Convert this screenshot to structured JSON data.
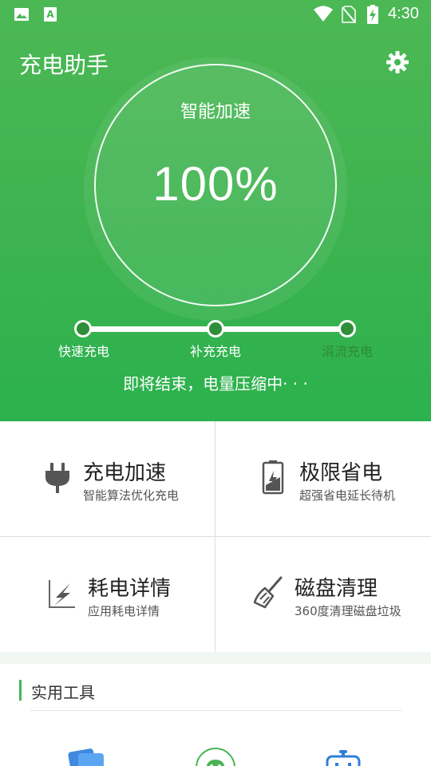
{
  "status_bar": {
    "time": "4:30",
    "icons": [
      "image-icon",
      "a-text-icon",
      "wifi-icon",
      "no-sim-icon",
      "battery-charging-icon"
    ]
  },
  "header": {
    "title": "充电助手",
    "settings_icon": "gear-icon"
  },
  "gauge": {
    "label": "智能加速",
    "value": "100%"
  },
  "stages": [
    {
      "label": "快速充电",
      "state": "done"
    },
    {
      "label": "补充充电",
      "state": "done"
    },
    {
      "label": "涓流充电",
      "state": "pending"
    }
  ],
  "status_text": "即将结束，电量压缩中· · ·",
  "features": [
    {
      "title": "充电加速",
      "subtitle": "智能算法优化充电",
      "icon": "plug-icon"
    },
    {
      "title": "极限省电",
      "subtitle": "超强省电延长待机",
      "icon": "battery-icon"
    },
    {
      "title": "耗电详情",
      "subtitle": "应用耗电详情",
      "icon": "power-drain-icon"
    },
    {
      "title": "磁盘清理",
      "subtitle": "360度清理磁盘垃圾",
      "icon": "broom-icon"
    }
  ],
  "tools": {
    "title": "实用工具",
    "items": [
      {
        "icon": "cards-icon"
      },
      {
        "icon": "android-icon"
      },
      {
        "icon": "robot-icon"
      }
    ]
  },
  "colors": {
    "primary_green": "#3db34f",
    "dark_green": "#2e8f3a",
    "accent_bar": "#47b556"
  }
}
